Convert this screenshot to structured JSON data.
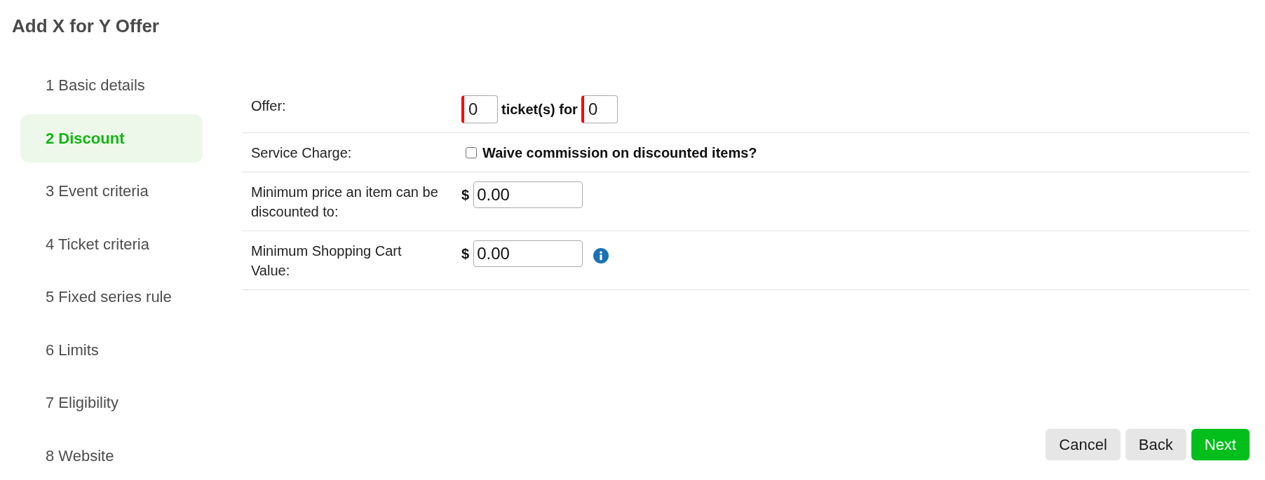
{
  "title": "Add X for Y Offer",
  "steps": [
    {
      "label": "1 Basic details",
      "selected": false
    },
    {
      "label": "2 Discount",
      "selected": true
    },
    {
      "label": "3 Event criteria",
      "selected": false
    },
    {
      "label": "4 Ticket criteria",
      "selected": false
    },
    {
      "label": "5 Fixed series rule",
      "selected": false
    },
    {
      "label": "6 Limits",
      "selected": false
    },
    {
      "label": "7 Eligibility",
      "selected": false
    },
    {
      "label": "8 Website",
      "selected": false
    }
  ],
  "form": {
    "rows": [
      {
        "kind": "offer",
        "label": "Offer:",
        "quantity": {
          "value": "0",
          "invalid": true
        },
        "connector": "ticket(s) for",
        "price_quantity": {
          "value": "0",
          "invalid": true
        }
      },
      {
        "kind": "checkbox",
        "label": "Service Charge:",
        "option": "Waive commission on discounted items?",
        "checked": false
      },
      {
        "kind": "money",
        "label": "Minimum price an item can be discounted to:",
        "currency": "$",
        "value": "0.00"
      },
      {
        "kind": "money",
        "label": "Minimum Shopping Cart Value:",
        "currency": "$",
        "value": "0.00",
        "info": true
      }
    ]
  },
  "buttons": [
    {
      "label": "Cancel",
      "kind": "secondary"
    },
    {
      "label": "Back",
      "kind": "secondary"
    },
    {
      "label": "Next",
      "kind": "primary"
    }
  ]
}
